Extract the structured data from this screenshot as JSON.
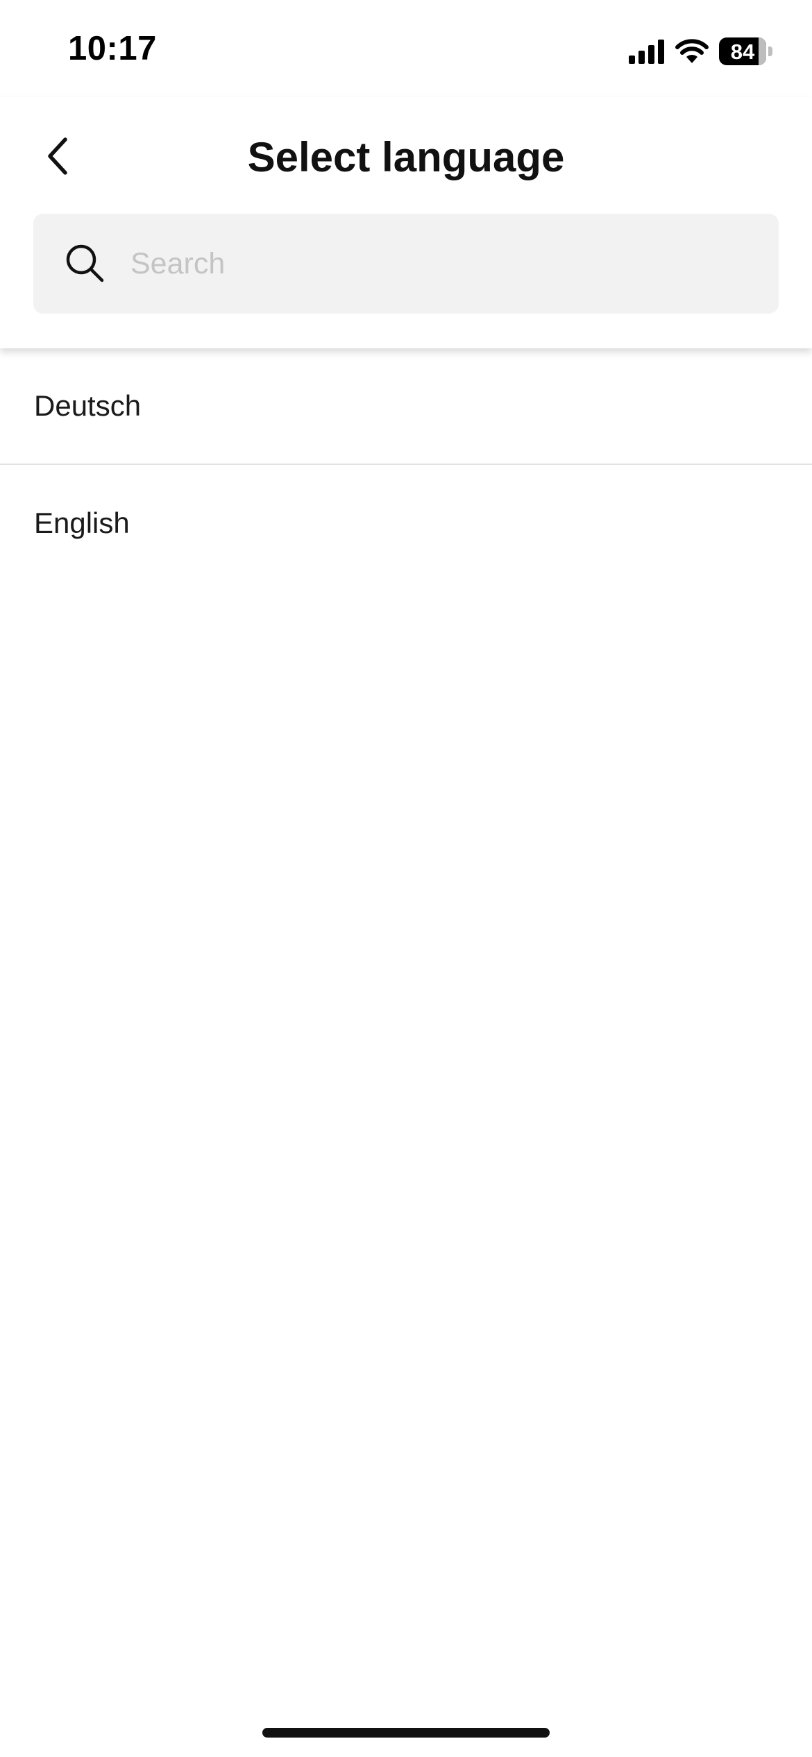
{
  "status_bar": {
    "time": "10:17",
    "battery_level": "84",
    "icons": [
      "signal-icon",
      "wifi-icon",
      "battery-icon"
    ]
  },
  "header": {
    "back_icon": "chevron-left-icon",
    "title": "Select language"
  },
  "search": {
    "icon": "search-icon",
    "placeholder": "Search",
    "value": ""
  },
  "languages": [
    {
      "label": "Deutsch"
    },
    {
      "label": "English"
    }
  ],
  "colors": {
    "background": "#ffffff",
    "search_background": "#f2f2f2",
    "placeholder": "#c4c4c4",
    "divider": "#e2e2e2",
    "text": "#111111"
  }
}
